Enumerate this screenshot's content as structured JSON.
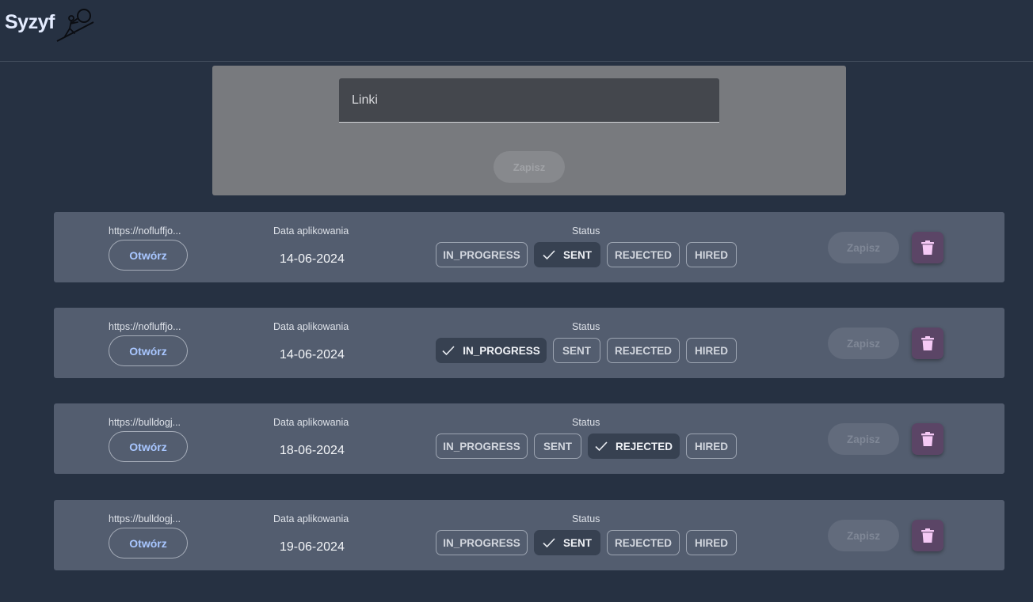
{
  "app": {
    "title": "Syzyf",
    "logo_icon": "sisyphus-boulder-icon"
  },
  "form": {
    "links_placeholder": "Linki",
    "links_value": "",
    "save_label": "Zapisz"
  },
  "labels": {
    "date": "Data aplikowania",
    "status": "Status",
    "open": "Otwórz",
    "save": "Zapisz"
  },
  "statuses": [
    "IN_PROGRESS",
    "SENT",
    "REJECTED",
    "HIRED"
  ],
  "applications": [
    {
      "url": "https://nofluffjo...",
      "date": "14-06-2024",
      "status": "SENT"
    },
    {
      "url": "https://nofluffjo...",
      "date": "14-06-2024",
      "status": "IN_PROGRESS"
    },
    {
      "url": "https://bulldogj...",
      "date": "18-06-2024",
      "status": "REJECTED"
    },
    {
      "url": "https://bulldogj...",
      "date": "19-06-2024",
      "status": "SENT"
    }
  ],
  "colors": {
    "background": "#263142",
    "card": "#535d6f",
    "selected_chip": "#374151",
    "link_accent": "#a8c6ff",
    "delete_button": "#5b4566",
    "delete_icon": "#f5c9f5"
  }
}
